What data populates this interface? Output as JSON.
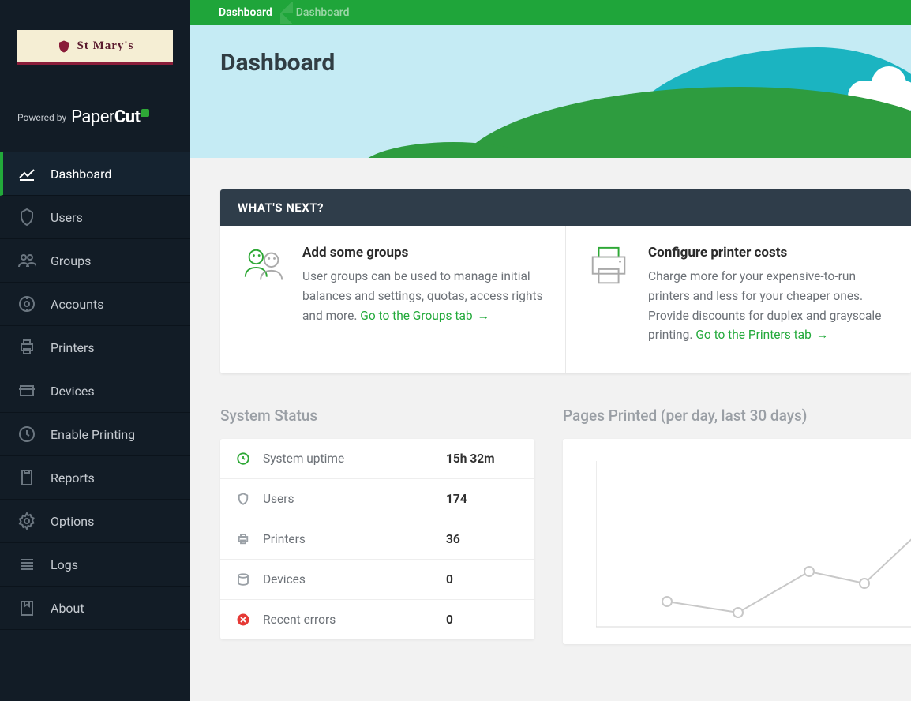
{
  "logo": {
    "text": "St Mary's"
  },
  "powered": {
    "prefix": "Powered by",
    "brand_a": "Paper",
    "brand_b": "Cut"
  },
  "sidebar": {
    "items": [
      {
        "label": "Dashboard"
      },
      {
        "label": "Users"
      },
      {
        "label": "Groups"
      },
      {
        "label": "Accounts"
      },
      {
        "label": "Printers"
      },
      {
        "label": "Devices"
      },
      {
        "label": "Enable Printing"
      },
      {
        "label": "Reports"
      },
      {
        "label": "Options"
      },
      {
        "label": "Logs"
      },
      {
        "label": "About"
      }
    ]
  },
  "breadcrumb": {
    "a": "Dashboard",
    "b": "Dashboard"
  },
  "hero": {
    "title": "Dashboard"
  },
  "next": {
    "header": "WHAT'S NEXT?",
    "card1": {
      "title": "Add some groups",
      "body": "User groups can be used to manage initial balances and settings, quotas, access rights and more. ",
      "link": "Go to the Groups tab"
    },
    "card2": {
      "title": "Configure printer costs",
      "body": "Charge more for your expensive-to-run printers and less for your cheaper ones. Provide discounts for duplex and grayscale printing. ",
      "link": "Go to the Printers tab"
    }
  },
  "status": {
    "title": "System Status",
    "rows": [
      {
        "label": "System uptime",
        "value": "15h 32m"
      },
      {
        "label": "Users",
        "value": "174"
      },
      {
        "label": "Printers",
        "value": "36"
      },
      {
        "label": "Devices",
        "value": "0"
      },
      {
        "label": "Recent errors",
        "value": "0"
      }
    ]
  },
  "chart": {
    "title": "Pages Printed (per day, last 30 days)"
  },
  "chart_data": {
    "type": "line",
    "title": "Pages Printed (per day, last 30 days)",
    "xlabel": "",
    "ylabel": "",
    "x": [
      0,
      1,
      2,
      3,
      4
    ],
    "values": [
      22,
      18,
      35,
      30,
      55
    ],
    "ylim": [
      0,
      60
    ]
  }
}
